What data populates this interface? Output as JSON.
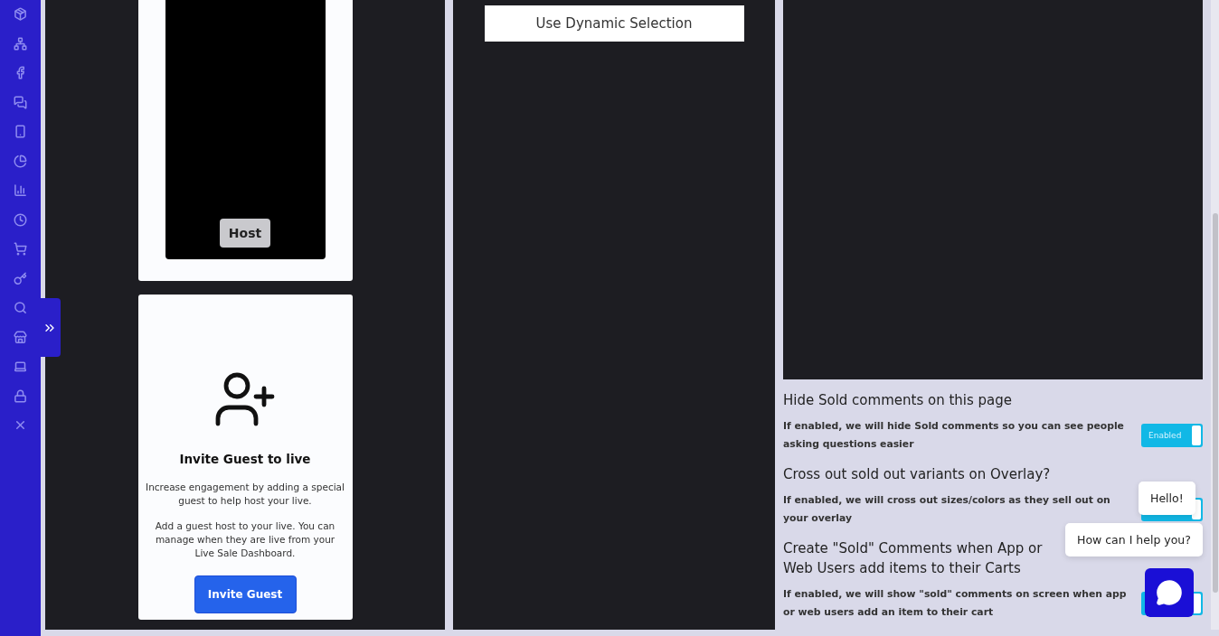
{
  "sidebar": {
    "expanded": false
  },
  "host_card": {
    "button": "Host"
  },
  "invite_card": {
    "title": "Invite Guest to live",
    "paragraphs": [
      "Increase engagement by adding a special guest to help host your live.",
      "Add a guest host to your live. You can manage when they are live from your Live Sale Dashboard."
    ],
    "button": "Invite Guest"
  },
  "selection_button": "Use Dynamic Selection",
  "settings": [
    {
      "title": "Hide Sold comments on this page",
      "description": "If enabled, we will hide Sold comments so you can see people asking questions easier",
      "on": true,
      "toggle_label": "Enabled"
    },
    {
      "title": "Cross out sold out variants on Overlay?",
      "description": "If enabled, we will cross out sizes/colors as they sell out on your overlay",
      "on": true
    },
    {
      "title": "Create \"Sold\" Comments when App or Web Users add items to their Carts",
      "description": "If enabled, we will show \"sold\" comments on screen when app or web users add an item to their cart",
      "on": true
    }
  ],
  "chat": {
    "messages": [
      "Hello!",
      "How can I help you?"
    ]
  }
}
